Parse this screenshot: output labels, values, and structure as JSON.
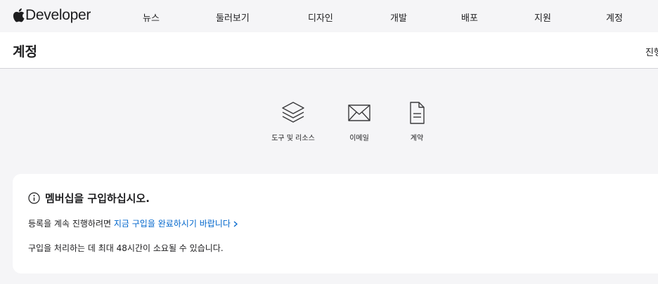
{
  "nav": {
    "brand": "Developer",
    "links": [
      "뉴스",
      "둘러보기",
      "디자인",
      "개발",
      "배포",
      "지원",
      "계정"
    ]
  },
  "local": {
    "title": "계정",
    "action": "진행"
  },
  "quick_links": [
    {
      "label": "도구 및 리소스",
      "icon": "layers-icon"
    },
    {
      "label": "이메일",
      "icon": "envelope-icon"
    },
    {
      "label": "계약",
      "icon": "document-icon"
    }
  ],
  "notice": {
    "title": "멤버십을 구입하십시오.",
    "line1_prefix": "등록을 계속 진행하려면",
    "line1_link": "지금 구입을 완료하시기 바랍니다",
    "line2": "구입을 처리하는 데 최대 48시간이 소요될 수 있습니다."
  },
  "colors": {
    "link": "#0066cc",
    "background": "#f5f5f7",
    "text": "#1d1d1f"
  }
}
